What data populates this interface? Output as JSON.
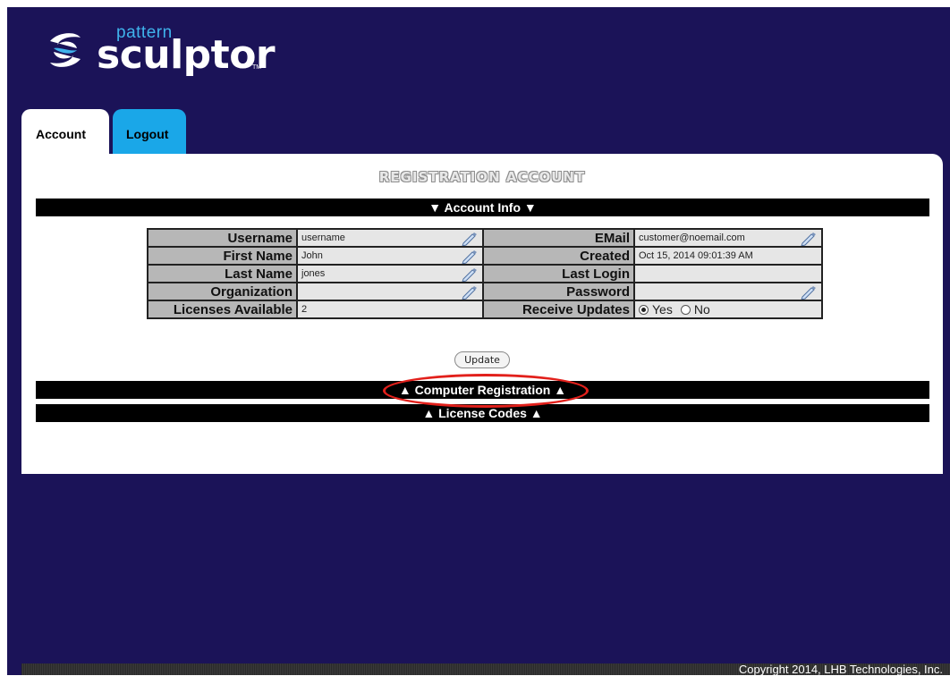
{
  "logo": {
    "top_text": "pattern",
    "main_text": "sculptor",
    "tm": "TM"
  },
  "tabs": [
    {
      "label": "Account",
      "active": true
    },
    {
      "label": "Logout",
      "active": false
    }
  ],
  "page_title": "REGISTRATION ACCOUNT",
  "sections": {
    "account_info": "▼ Account Info ▼",
    "computer_registration": "▲ Computer Registration ▲",
    "license_codes": "▲ License Codes ▲"
  },
  "account": {
    "username_label": "Username",
    "username_value": "username",
    "firstname_label": "First Name",
    "firstname_value": "John",
    "lastname_label": "Last Name",
    "lastname_value": "jones",
    "organization_label": "Organization",
    "organization_value": "",
    "licenses_label": "Licenses Available",
    "licenses_value": "2",
    "email_label": "EMail",
    "email_value": "customer@noemail.com",
    "created_label": "Created",
    "created_value": "Oct 15, 2014 09:01:39 AM",
    "lastlogin_label": "Last Login",
    "lastlogin_value": "",
    "password_label": "Password",
    "password_value": "",
    "updates_label": "Receive Updates",
    "updates_yes": "Yes",
    "updates_no": "No",
    "updates_selected": "Yes"
  },
  "update_button": "Update",
  "footer": "Copyright 2014, LHB Technologies, Inc.",
  "colors": {
    "background": "#1b1358",
    "tab_active": "#ffffff",
    "tab_inactive": "#1aa7e8",
    "highlight": "#e2201b"
  }
}
